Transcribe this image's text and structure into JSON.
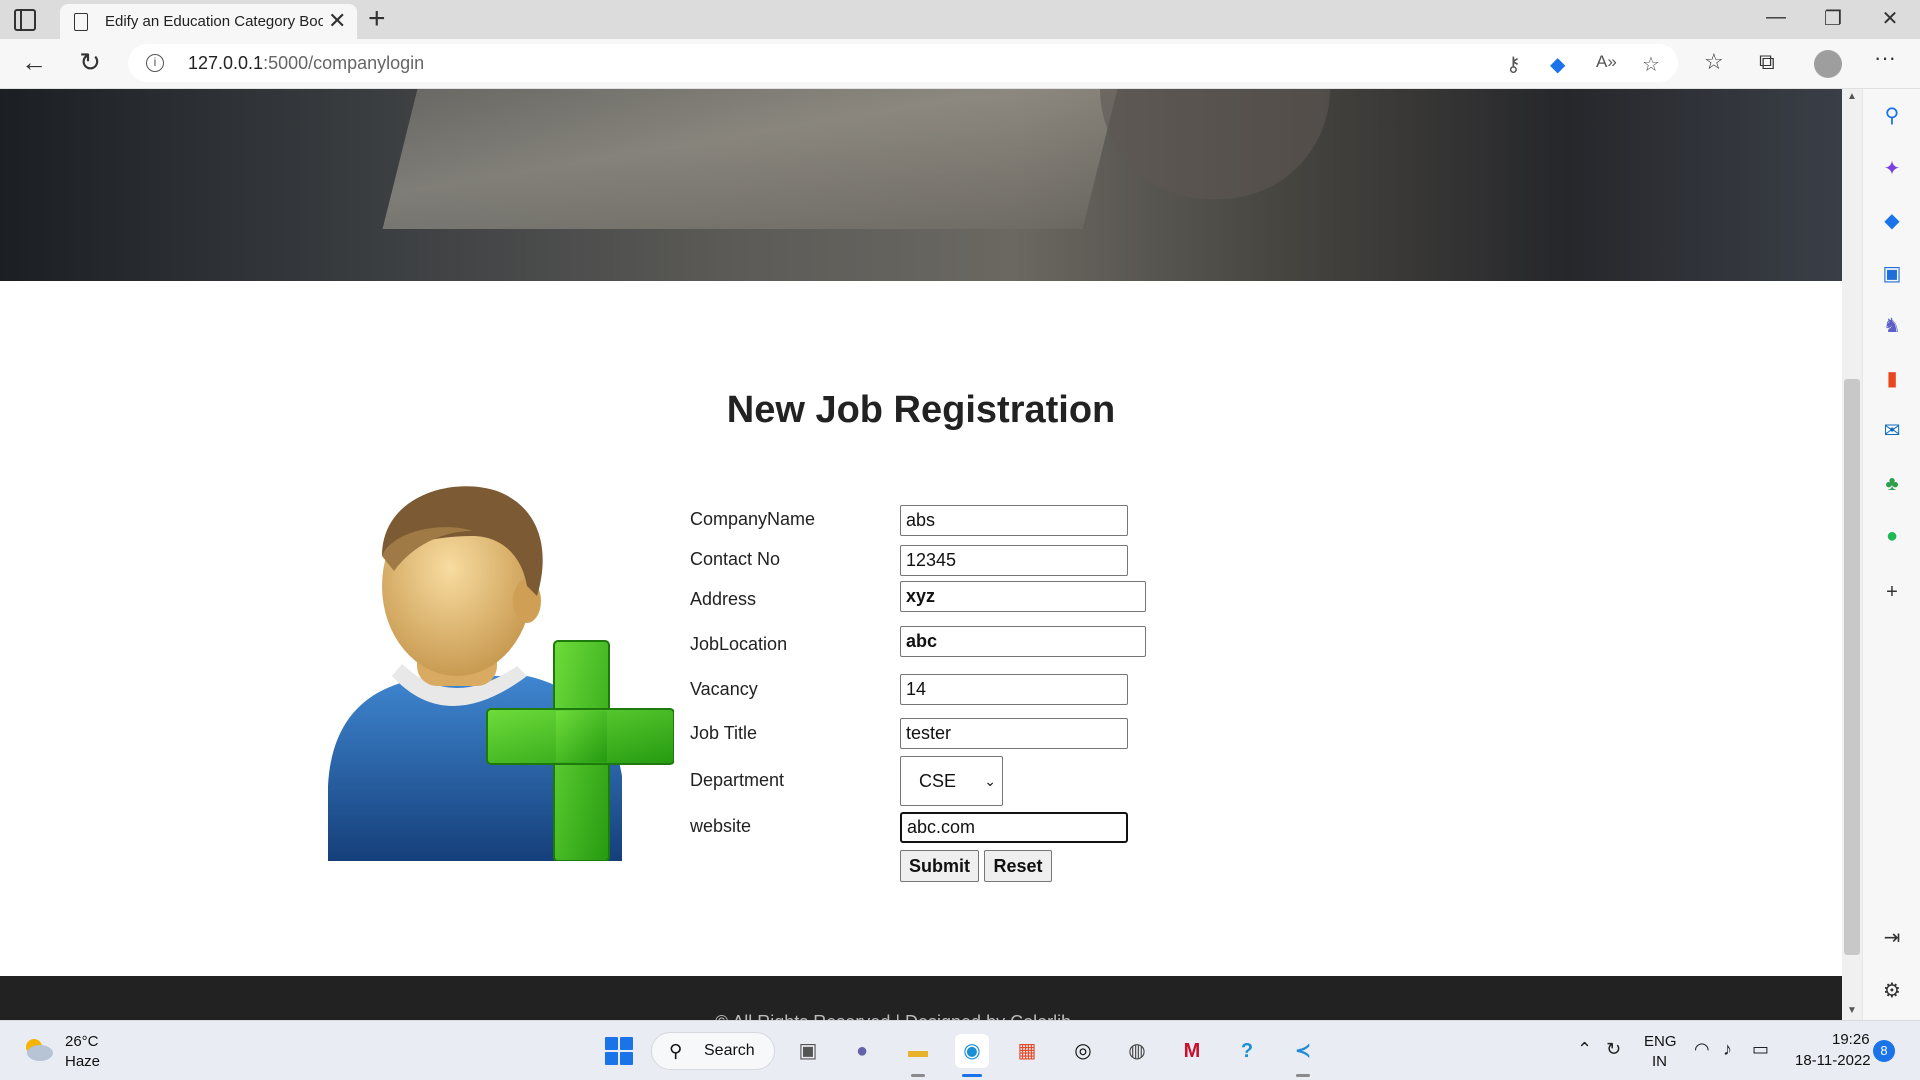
{
  "browser": {
    "tab_title": "Edify an Education Category Boo",
    "tab_close": "✕",
    "new_tab": "+",
    "window_controls": {
      "minimize": "—",
      "maximize": "❐",
      "close": "✕"
    },
    "url_host": "127.0.0.1",
    "url_path": ":5000/companylogin",
    "more": "···"
  },
  "page": {
    "title": "New Job Registration",
    "form": {
      "fields": [
        {
          "label": "CompanyName",
          "value": "abs"
        },
        {
          "label": "Contact No",
          "value": "12345"
        },
        {
          "label": "Address",
          "value": "xyz"
        },
        {
          "label": "JobLocation",
          "value": "abc"
        },
        {
          "label": "Vacancy",
          "value": "14"
        },
        {
          "label": "Job Title",
          "value": "tester"
        },
        {
          "label": "Department",
          "value": "CSE"
        },
        {
          "label": "website",
          "value": "abc.com"
        }
      ],
      "submit_label": "Submit",
      "reset_label": "Reset"
    },
    "footer_text": "© All Rights Reserved | Designed by Colorlib"
  },
  "taskbar": {
    "weather_temp": "26°C",
    "weather_desc": "Haze",
    "search_label": "Search",
    "lang_line1": "ENG",
    "lang_line2": "IN",
    "time": "19:26",
    "date": "18-11-2022",
    "notification_count": "8"
  },
  "colors": {
    "accent_blue": "#1a73e8",
    "plus_green": "#3fbf1f",
    "shirt_blue": "#1f5fa8",
    "footer_bg": "#222222"
  }
}
